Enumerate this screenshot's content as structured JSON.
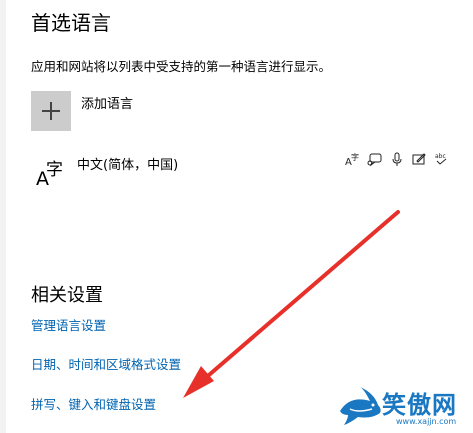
{
  "preferred_languages": {
    "title": "首选语言",
    "description": "应用和网站将以列表中受支持的第一种语言进行显示。",
    "add_language_label": "添加语言",
    "languages": [
      {
        "name": "中文(简体，中国)",
        "glyph_a": "A",
        "glyph_char": "字",
        "feature_icons": [
          "display-language-icon",
          "speech-icon",
          "microphone-icon",
          "handwriting-icon",
          "spellcheck-icon"
        ]
      }
    ]
  },
  "related_settings": {
    "title": "相关设置",
    "links": [
      "管理语言设置",
      "日期、时间和区域格式设置",
      "拼写、键入和键盘设置"
    ]
  },
  "watermark": {
    "text": "笑傲网",
    "url": "www.xajjn.com"
  },
  "colors": {
    "link": "#0063b1",
    "arrow": "#e8302a",
    "add_box": "#cccccc",
    "watermark": "#1a78c2"
  }
}
